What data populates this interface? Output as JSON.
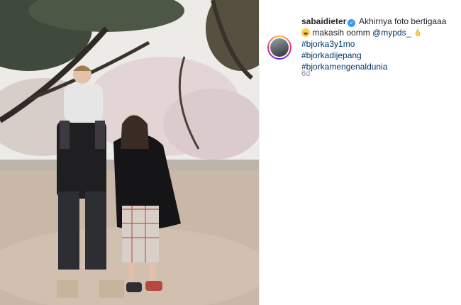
{
  "post": {
    "username": "sabaidieter",
    "caption_start": "Akhirnya foto bertigaaa",
    "caption_mid": "makasih oomm",
    "mention": "@mypds_",
    "hashtags": [
      "#bjorka3y1mo",
      "#bjorkadijepang",
      "#bjorkamengenaldunia"
    ],
    "time_ago": "6d"
  },
  "icons": {
    "verified": "verified-badge-icon",
    "emoji1": "grinning-sweat-emoji-icon",
    "emoji2": "folded-hands-emoji-icon"
  }
}
